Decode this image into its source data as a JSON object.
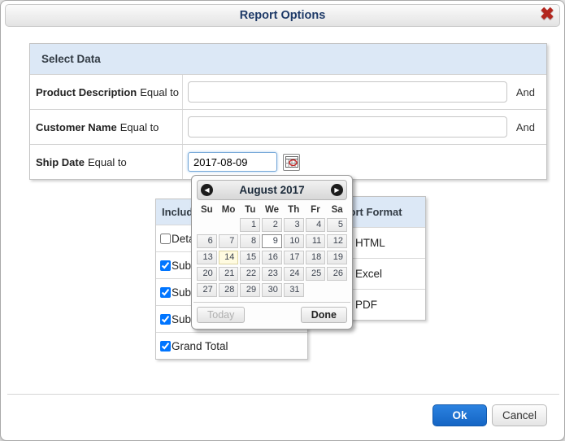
{
  "dialog": {
    "title": "Report Options",
    "close_icon": "✖"
  },
  "select_data": {
    "header": "Select Data",
    "rows": [
      {
        "field": "Product Description",
        "operator": "Equal to",
        "value": "",
        "conjunction": "And"
      },
      {
        "field": "Customer Name",
        "operator": "Equal to",
        "value": "",
        "conjunction": "And"
      },
      {
        "field": "Ship Date",
        "operator": "Equal to",
        "value": "2017-08-09",
        "conjunction": ""
      }
    ]
  },
  "include": {
    "header": "Include",
    "items": [
      {
        "label": "Detail",
        "checked": false
      },
      {
        "label": "Sub",
        "checked": true
      },
      {
        "label": "Sub",
        "checked": true
      },
      {
        "label": "Sub",
        "checked": true
      },
      {
        "label": "Grand Total",
        "checked": true
      }
    ]
  },
  "report_format": {
    "header": "Report Format",
    "options": [
      "HTML",
      "Excel",
      "PDF"
    ]
  },
  "datepicker": {
    "month_year": "August 2017",
    "prev_icon": "◀",
    "next_icon": "▶",
    "day_headers": [
      "Su",
      "Mo",
      "Tu",
      "We",
      "Th",
      "Fr",
      "Sa"
    ],
    "weeks": [
      [
        "",
        "",
        "1",
        "2",
        "3",
        "4",
        "5"
      ],
      [
        "6",
        "7",
        "8",
        "9",
        "10",
        "11",
        "12"
      ],
      [
        "13",
        "14",
        "15",
        "16",
        "17",
        "18",
        "19"
      ],
      [
        "20",
        "21",
        "22",
        "23",
        "24",
        "25",
        "26"
      ],
      [
        "27",
        "28",
        "29",
        "30",
        "31",
        "",
        ""
      ]
    ],
    "selected_day": "9",
    "today_day": "14",
    "today_label": "Today",
    "done_label": "Done"
  },
  "footer": {
    "ok": "Ok",
    "cancel": "Cancel"
  },
  "colors": {
    "accent_blue": "#1a6fd4",
    "section_header_bg": "#dce8f6",
    "title_text": "#1e3a68",
    "close_red": "#b3261e",
    "today_cell_bg": "#fffbe0",
    "focused_input_border": "#74a7d8"
  }
}
